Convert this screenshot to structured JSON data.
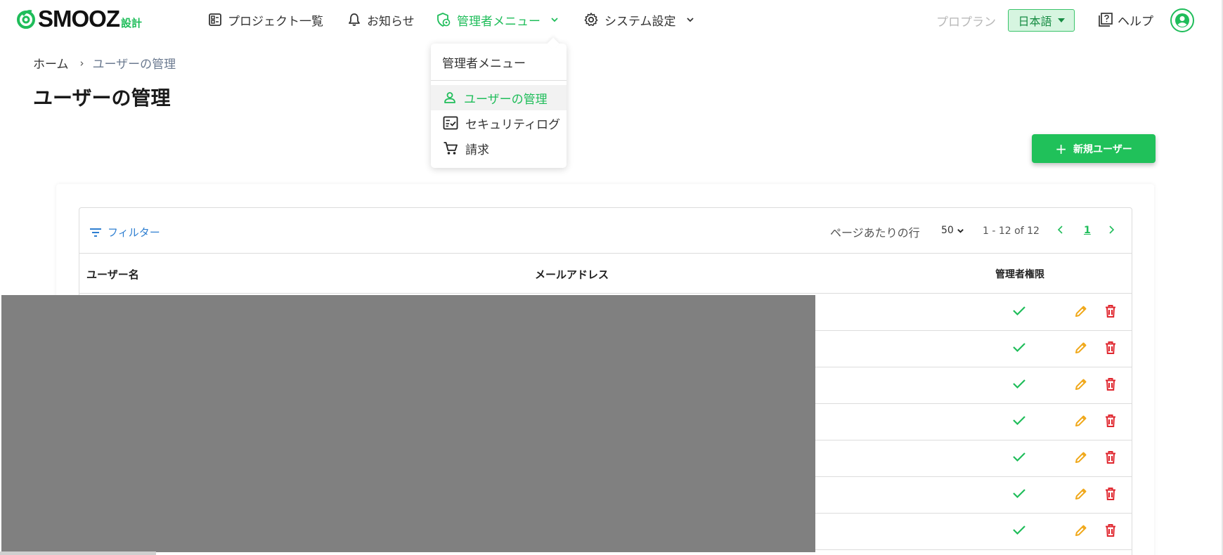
{
  "brand": {
    "name": "SMOOZ",
    "suffix": "設計",
    "accent": "#1fbd5a"
  },
  "nav": {
    "projects": "プロジェクト一覧",
    "notifications": "お知らせ",
    "admin_menu": "管理者メニュー",
    "system_settings": "システム設定"
  },
  "header_right": {
    "pro_plan": "プロプラン",
    "language": "日本語",
    "help": "ヘルプ"
  },
  "dropdown": {
    "header": "管理者メニュー",
    "items": [
      {
        "label": "ユーザーの管理",
        "icon": "person-icon",
        "active": true
      },
      {
        "label": "セキュリティログ",
        "icon": "checklist-icon",
        "active": false
      },
      {
        "label": "請求",
        "icon": "cart-icon",
        "active": false
      }
    ]
  },
  "breadcrumb": {
    "home": "ホーム",
    "current": "ユーザーの管理"
  },
  "page": {
    "title": "ユーザーの管理",
    "new_user_button": "新規ユーザー"
  },
  "table": {
    "filter_label": "フィルター",
    "rows_per_page_label": "ページあたりの行",
    "rows_per_page": "50",
    "range": "1 - 12 of 12",
    "current_page": "1",
    "columns": {
      "name": "ユーザー名",
      "email": "メールアドレス",
      "admin": "管理者権限"
    },
    "visible_rows": [
      {
        "admin": true
      },
      {
        "admin": true
      },
      {
        "admin": true
      },
      {
        "admin": true
      },
      {
        "admin": true
      },
      {
        "admin": true
      },
      {
        "admin": true
      }
    ]
  },
  "colors": {
    "check": "#1fbd5a",
    "edit": "#f0a81a",
    "delete": "#e0272f",
    "link": "#2f7fd1"
  }
}
